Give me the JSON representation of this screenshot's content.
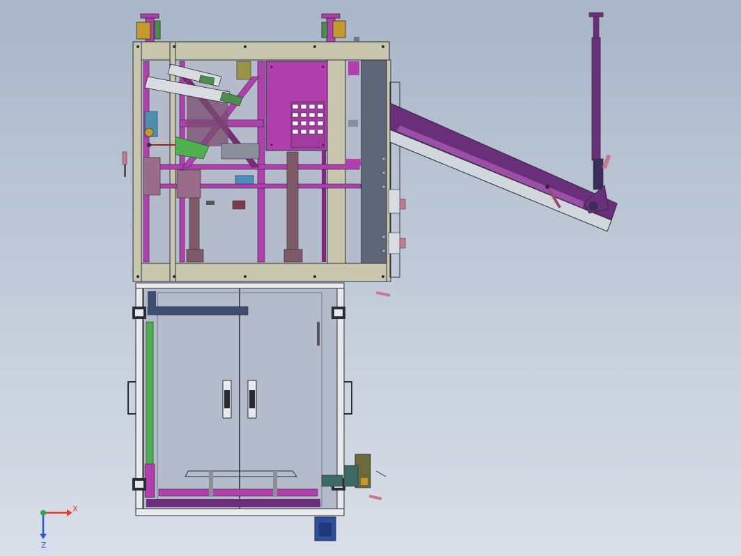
{
  "viewport": {
    "background_top": "#a9b6c9",
    "background_bottom": "#d9dfe8"
  },
  "colors": {
    "frame": "#c9c6ae",
    "frame_dark": "#8c8a77",
    "magenta": "#b13fae",
    "magenta_dark": "#7e2a7c",
    "purple": "#6a2f7a",
    "panel_gray": "#5d6676",
    "glass": "#b4bccb",
    "steel": "#9ea3ab",
    "green": "#4fb04f",
    "blue": "#2d4e9f",
    "navy": "#3d4f72",
    "outline": "#2b2b33"
  },
  "triad": {
    "x_label": "X",
    "z_label": "Z",
    "x_color": "#e23a2a",
    "z_color": "#2b58d6",
    "origin_color": "#2aa84a"
  }
}
